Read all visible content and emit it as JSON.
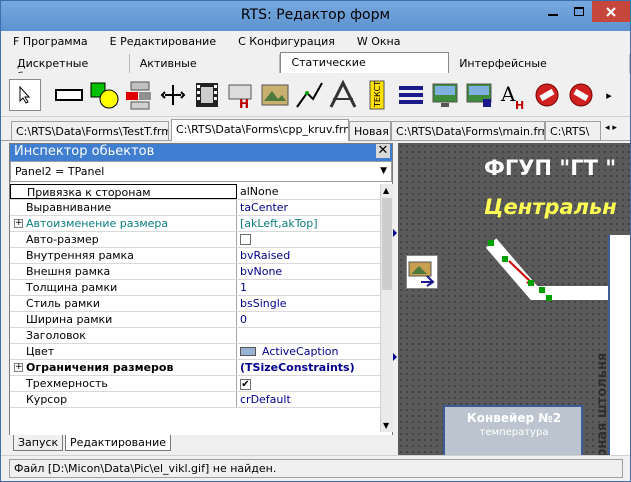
{
  "window": {
    "title": "RTS: Редактор форм"
  },
  "menu": [
    {
      "label": "F Программа"
    },
    {
      "label": "E Редактирование"
    },
    {
      "label": "C Конфигурация"
    },
    {
      "label": "W Окна"
    }
  ],
  "palette_tabs": [
    {
      "label": "Дискретные биты"
    },
    {
      "label": "Активные компоненты"
    },
    {
      "label": "Статические компоненты"
    },
    {
      "label": "Интерфейсные компоненты"
    }
  ],
  "toolbar": {
    "text_tool_letter": "A",
    "text_tool_sub": "H",
    "more_arrow": "▸"
  },
  "file_tabs": [
    {
      "label": "C:\\RTS\\Data\\Forms\\TestT.frm"
    },
    {
      "label": "C:\\RTS\\Data\\Forms\\cpp_kruv.frm"
    },
    {
      "label": "Новая"
    },
    {
      "label": "C:\\RTS\\Data\\Forms\\main.frm"
    },
    {
      "label": "C:\\RTS\\"
    }
  ],
  "inspector": {
    "title": "Инспектор обьектов",
    "close": "✕",
    "object": "Panel2 = TPanel",
    "rows": [
      {
        "name": "Привязка к сторонам",
        "value": "alNone"
      },
      {
        "name": "Выравнивание",
        "value": "taCenter"
      },
      {
        "name": "Автоизменение размера",
        "value": "[akLeft,akTop]"
      },
      {
        "name": "Авто-размер",
        "value": ""
      },
      {
        "name": "Внутренняя рамка",
        "value": "bvRaised"
      },
      {
        "name": "Внешня рамка",
        "value": "bvNone"
      },
      {
        "name": "Толщина рамки",
        "value": "1"
      },
      {
        "name": "Стиль рамки",
        "value": "bsSingle"
      },
      {
        "name": "Ширина рамки",
        "value": "0"
      },
      {
        "name": "Заголовок",
        "value": ""
      },
      {
        "name": "Цвет",
        "value": "ActiveCaption"
      },
      {
        "name": "Ограничения размеров",
        "value": "(TSizeConstraints)"
      },
      {
        "name": "Трехмерность",
        "value": ""
      },
      {
        "name": "Курсор",
        "value": "crDefault"
      }
    ],
    "expand_plus": "+",
    "check_mark": "✔"
  },
  "canvas": {
    "title1": "ФГУП \"ГТ \"",
    "title2": "Центральн",
    "wall_text": "рная штольня",
    "conveyor_label": "Конвейер №2",
    "conveyor_sub": "температура"
  },
  "bottom_tabs": [
    {
      "label": "Запуск"
    },
    {
      "label": "Редактирование"
    }
  ],
  "status": {
    "text": "Файл [D:\\Micon\\Data\\Pic\\el_vikl.gif] не найден."
  },
  "colors": {
    "accent": "#3f7ed0",
    "value_text": "#00008b",
    "canvas_bg": "#5a5a5a",
    "title_yellow": "#ffff55"
  }
}
